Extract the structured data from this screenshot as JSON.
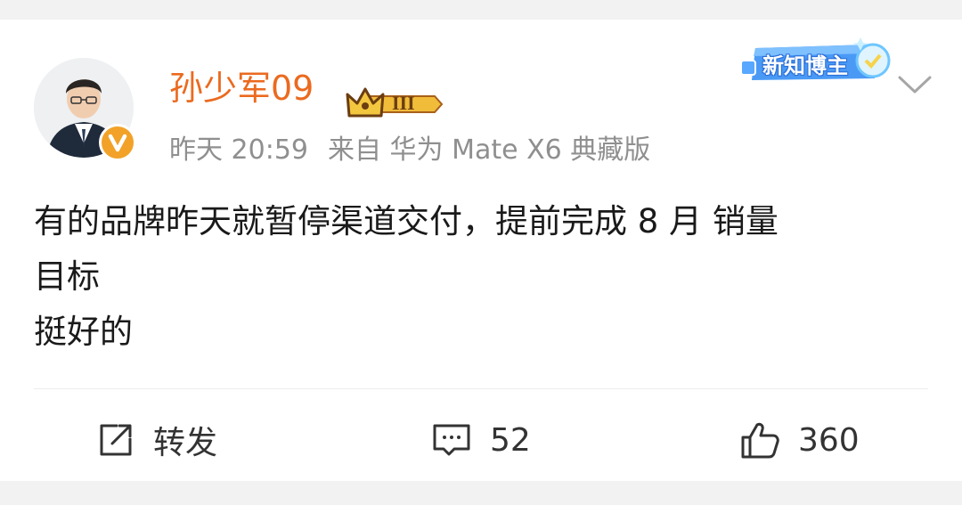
{
  "post": {
    "author": {
      "name": "孙少军09",
      "level_badge": "III"
    },
    "header_badge": "新知博主",
    "meta": {
      "time": "昨天 20:59",
      "source": "来自 华为 Mate X6 典藏版"
    },
    "content": {
      "line1": "有的品牌昨天就暂停渠道交付，提前完成 8 月 销量",
      "line2": "目标",
      "line3": "挺好的"
    },
    "actions": {
      "repost_label": "转发",
      "comment_count": "52",
      "like_count": "360"
    }
  },
  "colors": {
    "username": "#eb6a1f",
    "meta": "#8f8f8f",
    "verified_badge": "#f2a228",
    "new_blogger": "#3a8ef0"
  }
}
